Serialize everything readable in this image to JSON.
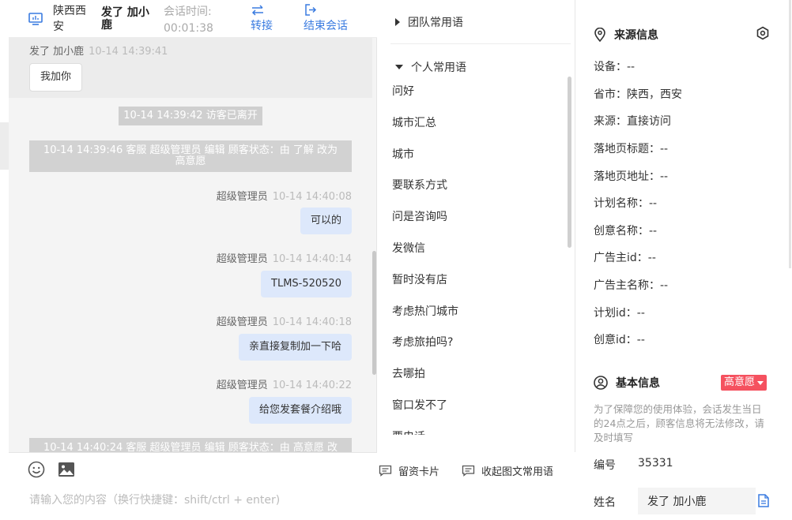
{
  "header": {
    "location": "陕西西安",
    "visitor_name": "发了 加小鹿",
    "session_time_label": "会话时间:",
    "session_time_value": "00:01:38",
    "transfer_label": "转接",
    "end_session_label": "结束会话"
  },
  "messages": {
    "visitor": {
      "name": "发了 加小鹿",
      "time": "10-14 14:39:41",
      "text": "我加你"
    },
    "system_left": "10-14 14:39:42 访客已离开",
    "system_status_1": "10-14 14:39:46 客服 超级管理员 编辑 顾客状态：由 了解 改为 高意愿",
    "agent": [
      {
        "name": "超级管理员",
        "time": "10-14 14:40:08",
        "text": "可以的"
      },
      {
        "name": "超级管理员",
        "time": "10-14 14:40:14",
        "text": "TLMS-520520"
      },
      {
        "name": "超级管理员",
        "time": "10-14 14:40:18",
        "text": "亲直接复制加一下哈"
      },
      {
        "name": "超级管理员",
        "time": "10-14 14:40:22",
        "text": "给您发套餐介绍哦"
      }
    ],
    "system_status_2": "10-14 14:40:24 客服 超级管理员 编辑 顾客状态：由 高意愿 改"
  },
  "composer": {
    "card_label": "留资卡片",
    "collapse_label": "收起图文常用语",
    "placeholder": "请输入您的内容（换行快捷键：shift/ctrl + enter)"
  },
  "phrases": {
    "team_group": "团队常用语",
    "personal_group": "个人常用语",
    "items": [
      "问好",
      "城市汇总",
      "城市",
      "要联系方式",
      "问是咨询吗",
      "发微信",
      "暂时没有店",
      "考虑热门城市",
      "考虑旅拍吗?",
      "去哪拍",
      "窗口发不了",
      "要电话"
    ]
  },
  "source_info": {
    "title": "来源信息",
    "rows": [
      "设备：--",
      "省市：陕西，西安",
      "来源：直接访问",
      "落地页标题：--",
      "落地页地址：--",
      "计划名称：--",
      "创意名称：--",
      "广告主id：--",
      "广告主名称：--",
      "计划id：--",
      "创意id：--"
    ]
  },
  "basic_info": {
    "title": "基本信息",
    "status_badge": "高意愿",
    "notice": "为了保障您的使用体验，会话发生当日的24点之后，顾客信息将无法修改，请及时填写",
    "id_label": "编号",
    "id_value": "35331",
    "name_label": "姓名",
    "name_value": "发了 加小鹿"
  },
  "colors": {
    "accent": "#3a7be0",
    "agent_bubble": "#dde8fb",
    "badge": "#f5515f"
  },
  "icons": [
    "monitor-icon",
    "transfer-icon",
    "exit-icon",
    "emoji-icon",
    "image-icon",
    "card-icon",
    "collapse-icon",
    "location-pin-icon",
    "settings-icon",
    "user-circle-icon",
    "copy-icon"
  ]
}
